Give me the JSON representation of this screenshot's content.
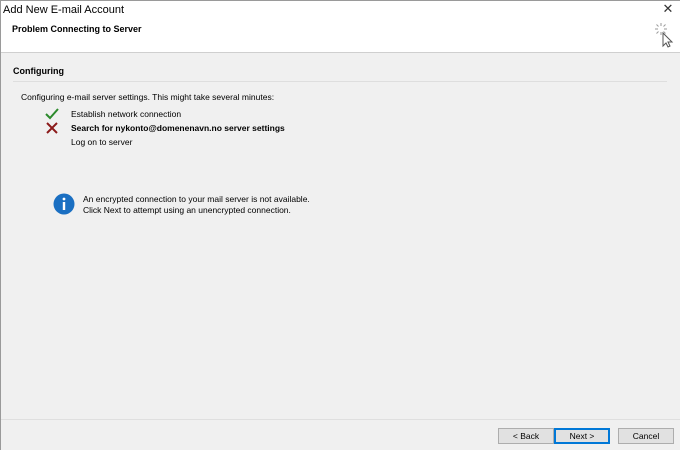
{
  "window": {
    "title": "Add New E-mail Account",
    "close_glyph": "✕"
  },
  "header": {
    "title": "Problem Connecting to Server",
    "icon": "busy-cursor-icon"
  },
  "section": {
    "title": "Configuring",
    "intro": "Configuring e-mail server settings. This might take several minutes:"
  },
  "steps": [
    {
      "label": "Establish network connection",
      "status": "success",
      "icon": "green-check-icon"
    },
    {
      "label": "Search for nykonto@domenenavn.no server settings",
      "status": "failed",
      "icon": "red-x-icon"
    },
    {
      "label": "Log on to server",
      "status": "pending",
      "icon": ""
    }
  ],
  "info": {
    "icon": "info-icon",
    "line1": "An encrypted connection to your mail server is not available.",
    "line2": "Click Next to attempt using an unencrypted connection."
  },
  "buttons": {
    "back": "< Back",
    "next": "Next >",
    "cancel": "Cancel"
  },
  "colors": {
    "accent": "#0078d7",
    "success": "#2c8a2c",
    "error": "#8b1a1a",
    "info": "#1a6fc2"
  }
}
